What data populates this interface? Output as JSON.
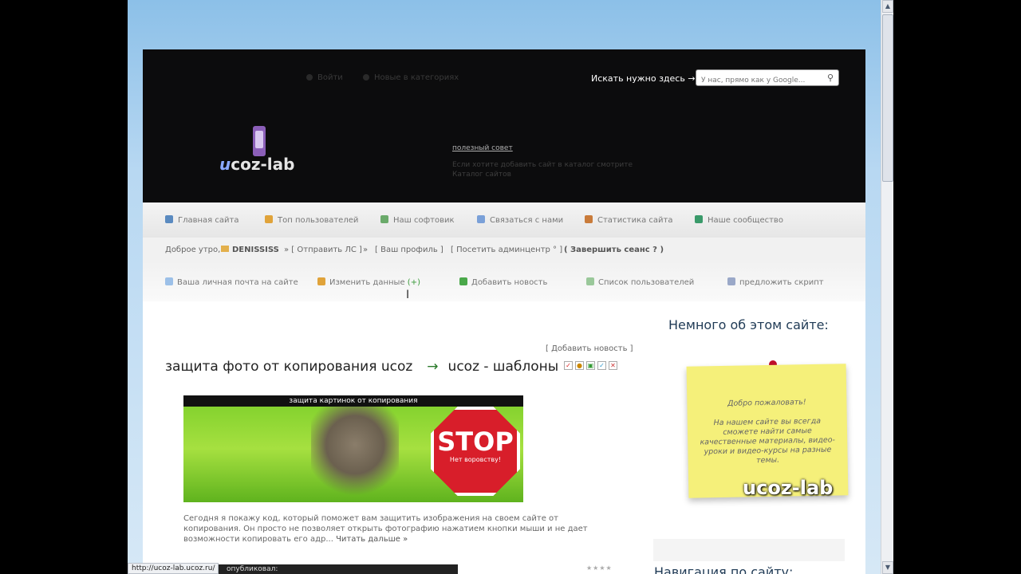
{
  "header": {
    "top_link_1": "Войти",
    "top_link_2": "Новые в категориях",
    "search_label": "Искать нужно здесь →",
    "search_placeholder": "У нас, прямо как у Google...",
    "logo_text_prefix": "u",
    "logo_text_rest": "coz-lab",
    "tip_title": "полезный совет",
    "tip_text": "Если хотите добавить сайт в каталог смотрите Каталог сайтов"
  },
  "nav": {
    "items": [
      {
        "label": "Главная сайта",
        "icon_color": "#5a8ac0"
      },
      {
        "label": "Топ пользователей",
        "icon_color": "#e0a33a"
      },
      {
        "label": "Наш софтовик",
        "icon_color": "#6aaa6a"
      },
      {
        "label": "Связаться с нами",
        "icon_color": "#7aa0d8"
      },
      {
        "label": "Статистика сайта",
        "icon_color": "#c97b3a"
      },
      {
        "label": "Наше сообщество",
        "icon_color": "#3a9a6a"
      }
    ]
  },
  "userbar": {
    "greeting": "Доброе утро,",
    "username": "DENISSISS",
    "send_pm": "» [ Отправить ЛС ]",
    "sep": "»",
    "profile": "[ Ваш профиль ]",
    "admin": "[ Посетить админцентр ° ]",
    "logout": "( Завершить сеанс ? )"
  },
  "toolbar": {
    "mail": "Ваша личная почта на сайте",
    "edit_data": "Изменить данные",
    "edit_plus": "(+)",
    "add_news": "Добавить новость",
    "user_list": "Список пользователей",
    "suggest": "предложить скрипт"
  },
  "post": {
    "add_news_link": "[ Добавить новость ]",
    "title": "защита фото от копирования ucoz",
    "arrow": "→",
    "category": "ucoz - шаблоны",
    "banner_title": "защита картинок от копирования",
    "stop_word": "STOP",
    "stop_sub": "Нет воровству!",
    "excerpt": "Сегодня я покажу код, который поможет вам защитить изображения на своем сайте от копирования. Он просто не позволяет открыть фотографию нажатием кнопки мыши и не дает возможности копировать его адр...",
    "read_more": "Читать дальше »"
  },
  "sidebar": {
    "about_title": "Немного об этом сайте:",
    "note_line1": "Добро пожаловать!",
    "note_body": "На нашем сайте вы всегда сможете найти самые качественные материалы, видео-уроки и видео-курсы на разные темы.",
    "note_logo": "ucoz-lab",
    "nav_heading": "Навигация по сайту:"
  },
  "status": {
    "url": "http://ucoz-lab.ucoz.ru/",
    "published": "опубликовал:"
  }
}
